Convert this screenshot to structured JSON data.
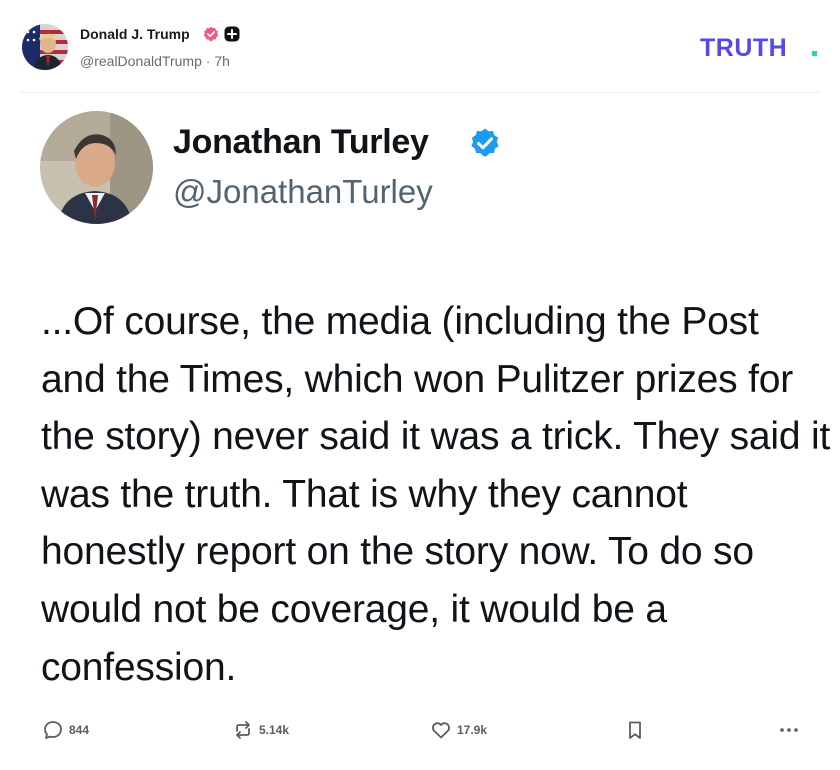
{
  "post": {
    "author_name": "Donald J. Trump",
    "author_handle": "@realDonaldTrump",
    "separator": "·",
    "time_ago": "7h",
    "brand": "TRUTH.",
    "brand_colors": {
      "main": "#5448ee",
      "dot": "#17e0b0"
    }
  },
  "embedded": {
    "name": "Jonathan Turley",
    "handle": "@JonathanTurley",
    "verified_color": "#1d9bf0",
    "text": "...Of course, the media (including the Post and the Times, which won Pulitzer prizes for the story) never said it was a trick. They said it was the truth. That is why they cannot honestly report on the story now. To do so would not be coverage, it would be a confession."
  },
  "actions": {
    "replies": "844",
    "reposts": "5.14k",
    "likes": "17.9k",
    "reply_icon": "reply-icon",
    "repost_icon": "repost-icon",
    "like_icon": "heart-icon",
    "bookmark_icon": "bookmark-icon",
    "more_icon": "more-icon"
  }
}
